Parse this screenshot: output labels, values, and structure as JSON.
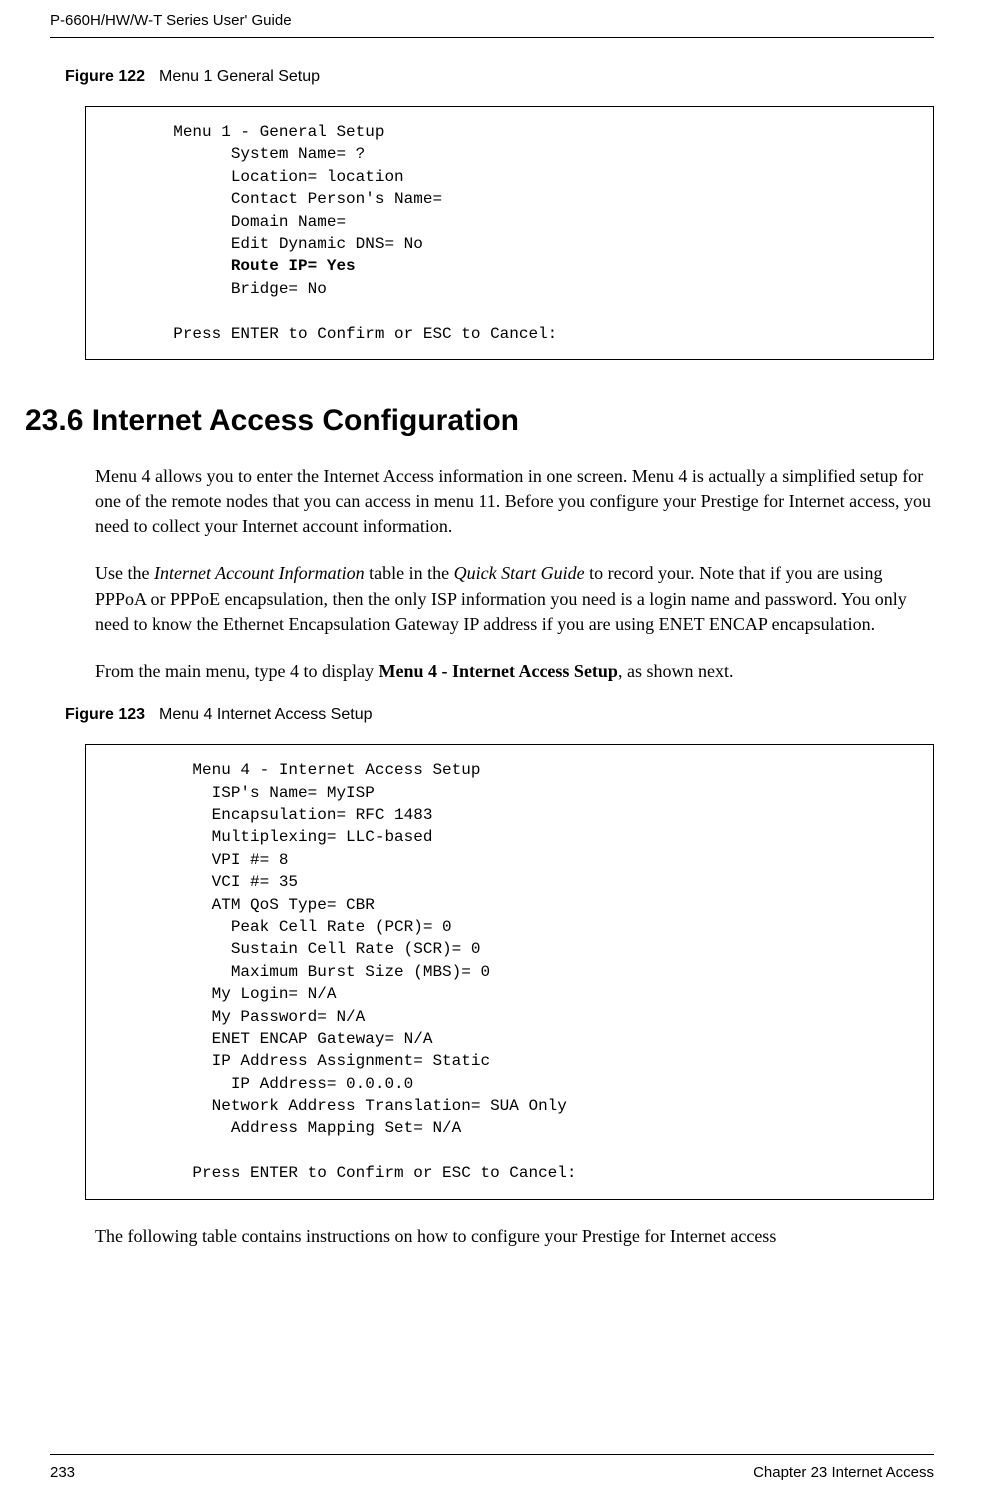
{
  "header": {
    "guide_title": "P-660H/HW/W-T Series User' Guide"
  },
  "figure1": {
    "label": "Figure 122",
    "title": "Menu 1 General Setup",
    "line1": "       Menu 1 - General Setup",
    "line2": "             System Name= ?",
    "line3": "             Location= location",
    "line4": "             Contact Person's Name=",
    "line5": "             Domain Name=",
    "line6": "             Edit Dynamic DNS= No",
    "line7": "             Route IP= Yes",
    "line8": "             Bridge= No",
    "line9": "",
    "line10": "       Press ENTER to Confirm or ESC to Cancel:"
  },
  "section": {
    "heading": "23.6  Internet Access Configuration",
    "para1": "Menu 4 allows you to enter the Internet Access information in one screen.  Menu 4 is actually a simplified setup for one of the remote nodes that you can access in menu 11.  Before you configure your Prestige for Internet access, you need to collect your Internet account information.",
    "para2_pre": "Use the ",
    "para2_italic1": "Internet Account Information",
    "para2_mid1": " table in the ",
    "para2_italic2": "Quick Start Guide",
    "para2_post1": " to record your. Note that if you are using PPPoA or PPPoE encapsulation, then the only ISP information you need is a login name and password. You only need to know the Ethernet Encapsulation Gateway IP address if you are using ENET ENCAP encapsulation.",
    "para3_pre": "From the main menu, type 4 to display ",
    "para3_bold": "Menu 4 - Internet Access Setup",
    "para3_post": ", as shown next."
  },
  "figure2": {
    "label": "Figure 123",
    "title": "Menu 4 Internet Access Setup",
    "line1": "         Menu 4 - Internet Access Setup",
    "line2": "           ISP's Name= MyISP",
    "line3": "           Encapsulation= RFC 1483",
    "line4": "           Multiplexing= LLC-based",
    "line5": "           VPI #= 8",
    "line6": "           VCI #= 35",
    "line7": "           ATM QoS Type= CBR",
    "line8": "             Peak Cell Rate (PCR)= 0",
    "line9": "             Sustain Cell Rate (SCR)= 0",
    "line10": "             Maximum Burst Size (MBS)= 0",
    "line11": "           My Login= N/A",
    "line12": "           My Password= N/A",
    "line13": "           ENET ENCAP Gateway= N/A",
    "line14": "           IP Address Assignment= Static",
    "line15": "             IP Address= 0.0.0.0",
    "line16": "           Network Address Translation= SUA Only",
    "line17": "             Address Mapping Set= N/A",
    "line18": "",
    "line19": "         Press ENTER to Confirm or ESC to Cancel:"
  },
  "closing_text": "The following table contains instructions on how to configure your Prestige for Internet access",
  "footer": {
    "page_number": "233",
    "chapter_title": "Chapter 23 Internet Access"
  }
}
